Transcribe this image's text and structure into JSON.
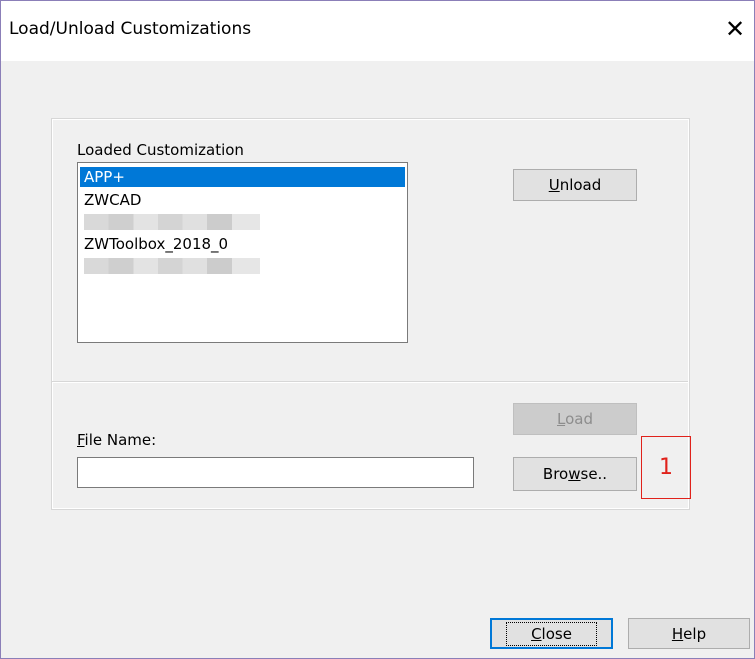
{
  "window": {
    "title": "Load/Unload Customizations",
    "close_glyph": "✕"
  },
  "loaded": {
    "label": "Loaded Customization",
    "items": [
      {
        "text": "APP+",
        "selected": true
      },
      {
        "text": "ZWCAD",
        "selected": false
      },
      {
        "text": "",
        "blurred": true
      },
      {
        "text": "ZWToolbox_2018_0",
        "selected": false
      },
      {
        "text": "",
        "blurred": true
      }
    ]
  },
  "buttons": {
    "unload": {
      "pre": "",
      "mnemonic": "U",
      "post": "nload"
    },
    "load": {
      "pre": "",
      "mnemonic": "L",
      "post": "oad",
      "disabled": true
    },
    "browse": {
      "pre": "Bro",
      "mnemonic": "w",
      "post": "se.."
    },
    "close": {
      "pre": "",
      "mnemonic": "C",
      "post": "lose"
    },
    "help": {
      "pre": "",
      "mnemonic": "H",
      "post": "elp"
    }
  },
  "file_name": {
    "label_mnemonic": "F",
    "label_rest": "ile Name:",
    "value": ""
  },
  "annotation": {
    "number": "1",
    "color": "#e0221b"
  },
  "colors": {
    "selection": "#0078d7",
    "dialog_bg": "#f0f0f0"
  }
}
